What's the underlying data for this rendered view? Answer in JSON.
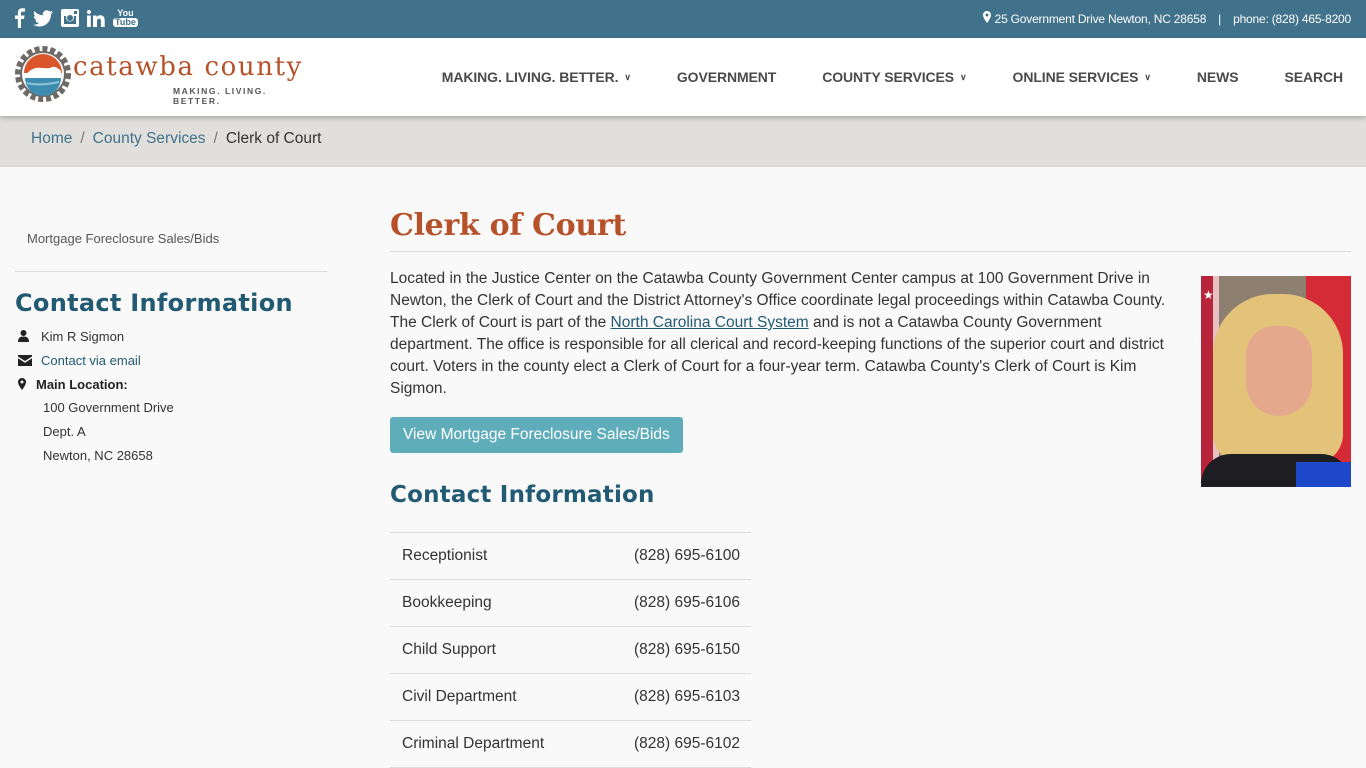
{
  "topbar": {
    "social": [
      {
        "name": "facebook-icon"
      },
      {
        "name": "twitter-icon"
      },
      {
        "name": "instagram-icon"
      },
      {
        "name": "linkedin-icon"
      },
      {
        "name": "youtube-icon",
        "label_top": "You",
        "label_bottom": "Tube"
      }
    ],
    "address": "25 Government Drive Newton, NC 28658",
    "separator": "|",
    "phone": "phone: (828) 465-8200"
  },
  "header": {
    "logo_text": "catawba county",
    "logo_tagline": "MAKING. LIVING. BETTER.",
    "nav": [
      {
        "label": "MAKING. LIVING. BETTER.",
        "dropdown": true
      },
      {
        "label": "GOVERNMENT",
        "dropdown": false
      },
      {
        "label": "COUNTY SERVICES",
        "dropdown": true
      },
      {
        "label": "ONLINE SERVICES",
        "dropdown": true
      },
      {
        "label": "NEWS",
        "dropdown": false
      },
      {
        "label": "SEARCH",
        "dropdown": false
      }
    ],
    "caret": "⌄"
  },
  "breadcrumb": {
    "items": [
      "Home",
      "County Services"
    ],
    "separator": "/",
    "current": "Clerk of Court"
  },
  "sidebar": {
    "link": "Mortgage Foreclosure Sales/Bids",
    "heading": "Contact Information",
    "name": "Kim R Sigmon",
    "email_link": "Contact via email",
    "location_label": "Main Location:",
    "address": [
      "100 Government Drive",
      "Dept. A",
      "Newton, NC 28658"
    ]
  },
  "main": {
    "title": "Clerk of Court",
    "intro_before_link": "Located in the Justice Center on the Catawba County Government Center campus at 100 Government Drive in Newton, the Clerk of Court and the District Attorney's Office coordinate legal proceedings within Catawba County. The Clerk of Court is part of the ",
    "intro_link": "North Carolina Court System",
    "intro_after_link": " and is not a Catawba County Government department. The office is responsible for all clerical and record-keeping functions of the superior court and district court. Voters in the county elect a Clerk of Court for a four-year term. Catawba County's Clerk of Court is Kim Sigmon.",
    "photo_alt": "Kim Sigmon portrait",
    "button": "View Mortgage Foreclosure Sales/Bids",
    "contact_heading": "Contact Information",
    "contacts": [
      {
        "dept": "Receptionist",
        "phone": "(828) 695-6100"
      },
      {
        "dept": "Bookkeeping",
        "phone": "(828) 695-6106"
      },
      {
        "dept": "Child Support",
        "phone": "(828) 695-6150"
      },
      {
        "dept": "Civil Department",
        "phone": "(828) 695-6103"
      },
      {
        "dept": "Criminal Department",
        "phone": "(828) 695-6102"
      }
    ]
  },
  "colors": {
    "topbar": "#41728b",
    "brand_orange": "#b6522a",
    "heading_blue": "#225a74",
    "button": "#5fadbb",
    "breadcrumb_bg": "#e0dfdb"
  }
}
